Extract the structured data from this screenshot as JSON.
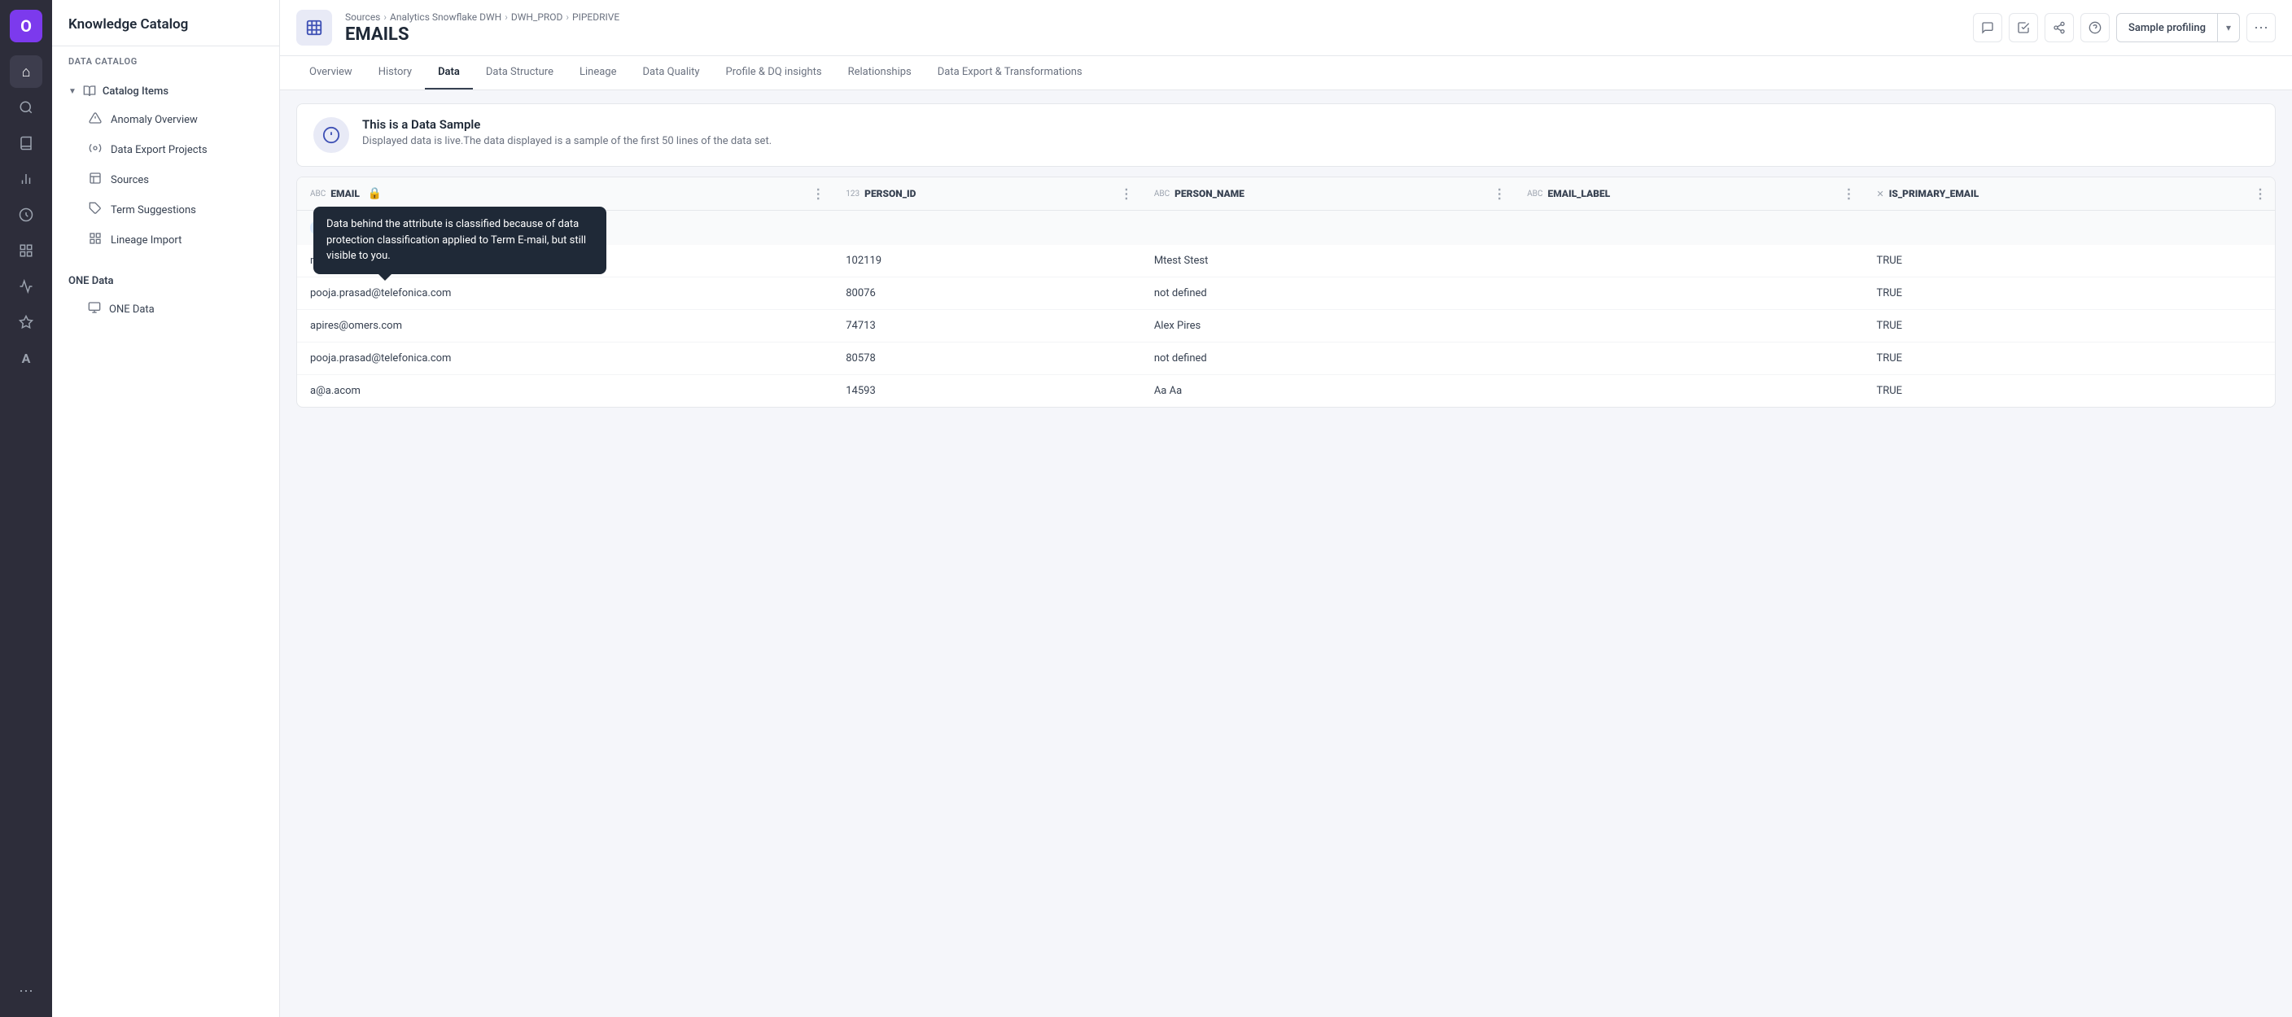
{
  "app": {
    "logo": "O",
    "sidebar_title": "Knowledge Catalog"
  },
  "nav_icons": [
    {
      "name": "home-icon",
      "symbol": "⌂"
    },
    {
      "name": "search-icon",
      "symbol": "🔍"
    },
    {
      "name": "book-icon",
      "symbol": "📖"
    },
    {
      "name": "chart-icon",
      "symbol": "📊"
    },
    {
      "name": "target-icon",
      "symbol": "🎯"
    },
    {
      "name": "grid-icon",
      "symbol": "⊞"
    },
    {
      "name": "analytics-icon",
      "symbol": "📈"
    },
    {
      "name": "crown-icon",
      "symbol": "♛"
    },
    {
      "name": "font-icon",
      "symbol": "A"
    },
    {
      "name": "bar-chart-icon",
      "symbol": "▦"
    }
  ],
  "sidebar": {
    "section_label": "Data Catalog",
    "catalog_items_label": "Catalog Items",
    "items": [
      {
        "name": "Anomaly Overview",
        "icon": "△",
        "key": "anomaly-overview"
      },
      {
        "name": "Data Export Projects",
        "icon": "⚙",
        "key": "data-export-projects"
      },
      {
        "name": "Sources",
        "icon": "⊟",
        "key": "sources"
      },
      {
        "name": "Term Suggestions",
        "icon": "🏷",
        "key": "term-suggestions"
      },
      {
        "name": "Lineage Import",
        "icon": "⊞",
        "key": "lineage-import"
      }
    ],
    "one_data_label": "ONE Data",
    "one_data_items": [
      {
        "name": "ONE Data",
        "icon": "⊡",
        "key": "one-data"
      }
    ]
  },
  "breadcrumb": {
    "items": [
      "Sources",
      "Analytics Snowflake DWH",
      "DWH_PROD",
      "PIPEDRIVE"
    ]
  },
  "header": {
    "icon": "≡",
    "title": "EMAILS",
    "sample_profiling_label": "Sample profiling"
  },
  "tabs": [
    {
      "label": "Overview",
      "key": "overview",
      "active": false
    },
    {
      "label": "History",
      "key": "history",
      "active": false
    },
    {
      "label": "Data",
      "key": "data",
      "active": true
    },
    {
      "label": "Data Structure",
      "key": "data-structure",
      "active": false
    },
    {
      "label": "Lineage",
      "key": "lineage",
      "active": false
    },
    {
      "label": "Data Quality",
      "key": "data-quality",
      "active": false
    },
    {
      "label": "Profile & DQ insights",
      "key": "profile-dq",
      "active": false
    },
    {
      "label": "Relationships",
      "key": "relationships",
      "active": false
    },
    {
      "label": "Data Export & Transformations",
      "key": "data-export",
      "active": false
    }
  ],
  "banner": {
    "title": "This is a Data Sample",
    "subtitle": "Displayed data is live.The data displayed is a sample of the first 50 lines of the data set."
  },
  "tooltip": {
    "text": "Data behind the attribute is classified because of data protection classification applied to Term E-mail, but still visible to you."
  },
  "table": {
    "columns": [
      {
        "key": "email",
        "label": "EMAIL",
        "type": "Abc",
        "locked": true,
        "tag": "E-mail"
      },
      {
        "key": "person_id",
        "label": "PERSON_ID",
        "type": "123",
        "locked": false,
        "tag": null
      },
      {
        "key": "person_name",
        "label": "PERSON_NAME",
        "type": "Abc",
        "locked": false,
        "tag": null
      },
      {
        "key": "email_label",
        "label": "EMAIL_LABEL",
        "type": "Abc",
        "locked": false,
        "tag": null
      },
      {
        "key": "is_primary_email",
        "label": "IS_PRIMARY_EMAIL",
        "type": "✕",
        "locked": false,
        "tag": null
      }
    ],
    "rows": [
      {
        "email": "mstest@atacdevtest.none",
        "person_id": "102119",
        "person_name": "Mtest Stest",
        "email_label": "",
        "is_primary_email": "TRUE"
      },
      {
        "email": "pooja.prasad@telefonica.com",
        "person_id": "80076",
        "person_name": "not defined",
        "email_label": "",
        "is_primary_email": "TRUE"
      },
      {
        "email": "apires@omers.com",
        "person_id": "74713",
        "person_name": "Alex Pires",
        "email_label": "",
        "is_primary_email": "TRUE"
      },
      {
        "email": "pooja.prasad@telefonica.com",
        "person_id": "80578",
        "person_name": "not defined",
        "email_label": "",
        "is_primary_email": "TRUE"
      },
      {
        "email": "a@a.acom",
        "person_id": "14593",
        "person_name": "Aa Aa",
        "email_label": "",
        "is_primary_email": "TRUE"
      }
    ]
  }
}
